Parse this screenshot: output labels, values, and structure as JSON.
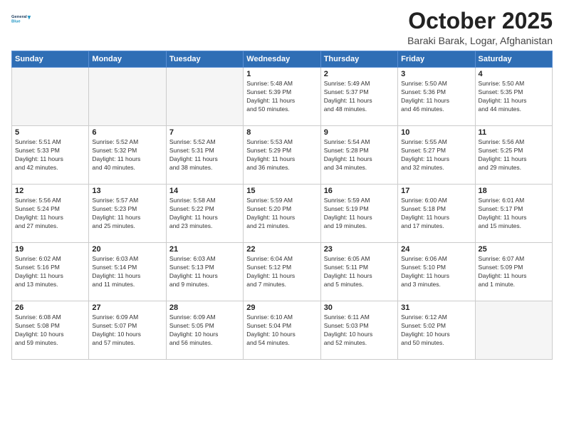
{
  "logo": {
    "line1": "General",
    "line2": "Blue"
  },
  "header": {
    "month": "October 2025",
    "location": "Baraki Barak, Logar, Afghanistan"
  },
  "weekdays": [
    "Sunday",
    "Monday",
    "Tuesday",
    "Wednesday",
    "Thursday",
    "Friday",
    "Saturday"
  ],
  "weeks": [
    [
      {
        "day": "",
        "info": ""
      },
      {
        "day": "",
        "info": ""
      },
      {
        "day": "",
        "info": ""
      },
      {
        "day": "1",
        "info": "Sunrise: 5:48 AM\nSunset: 5:39 PM\nDaylight: 11 hours\nand 50 minutes."
      },
      {
        "day": "2",
        "info": "Sunrise: 5:49 AM\nSunset: 5:37 PM\nDaylight: 11 hours\nand 48 minutes."
      },
      {
        "day": "3",
        "info": "Sunrise: 5:50 AM\nSunset: 5:36 PM\nDaylight: 11 hours\nand 46 minutes."
      },
      {
        "day": "4",
        "info": "Sunrise: 5:50 AM\nSunset: 5:35 PM\nDaylight: 11 hours\nand 44 minutes."
      }
    ],
    [
      {
        "day": "5",
        "info": "Sunrise: 5:51 AM\nSunset: 5:33 PM\nDaylight: 11 hours\nand 42 minutes."
      },
      {
        "day": "6",
        "info": "Sunrise: 5:52 AM\nSunset: 5:32 PM\nDaylight: 11 hours\nand 40 minutes."
      },
      {
        "day": "7",
        "info": "Sunrise: 5:52 AM\nSunset: 5:31 PM\nDaylight: 11 hours\nand 38 minutes."
      },
      {
        "day": "8",
        "info": "Sunrise: 5:53 AM\nSunset: 5:29 PM\nDaylight: 11 hours\nand 36 minutes."
      },
      {
        "day": "9",
        "info": "Sunrise: 5:54 AM\nSunset: 5:28 PM\nDaylight: 11 hours\nand 34 minutes."
      },
      {
        "day": "10",
        "info": "Sunrise: 5:55 AM\nSunset: 5:27 PM\nDaylight: 11 hours\nand 32 minutes."
      },
      {
        "day": "11",
        "info": "Sunrise: 5:56 AM\nSunset: 5:25 PM\nDaylight: 11 hours\nand 29 minutes."
      }
    ],
    [
      {
        "day": "12",
        "info": "Sunrise: 5:56 AM\nSunset: 5:24 PM\nDaylight: 11 hours\nand 27 minutes."
      },
      {
        "day": "13",
        "info": "Sunrise: 5:57 AM\nSunset: 5:23 PM\nDaylight: 11 hours\nand 25 minutes."
      },
      {
        "day": "14",
        "info": "Sunrise: 5:58 AM\nSunset: 5:22 PM\nDaylight: 11 hours\nand 23 minutes."
      },
      {
        "day": "15",
        "info": "Sunrise: 5:59 AM\nSunset: 5:20 PM\nDaylight: 11 hours\nand 21 minutes."
      },
      {
        "day": "16",
        "info": "Sunrise: 5:59 AM\nSunset: 5:19 PM\nDaylight: 11 hours\nand 19 minutes."
      },
      {
        "day": "17",
        "info": "Sunrise: 6:00 AM\nSunset: 5:18 PM\nDaylight: 11 hours\nand 17 minutes."
      },
      {
        "day": "18",
        "info": "Sunrise: 6:01 AM\nSunset: 5:17 PM\nDaylight: 11 hours\nand 15 minutes."
      }
    ],
    [
      {
        "day": "19",
        "info": "Sunrise: 6:02 AM\nSunset: 5:16 PM\nDaylight: 11 hours\nand 13 minutes."
      },
      {
        "day": "20",
        "info": "Sunrise: 6:03 AM\nSunset: 5:14 PM\nDaylight: 11 hours\nand 11 minutes."
      },
      {
        "day": "21",
        "info": "Sunrise: 6:03 AM\nSunset: 5:13 PM\nDaylight: 11 hours\nand 9 minutes."
      },
      {
        "day": "22",
        "info": "Sunrise: 6:04 AM\nSunset: 5:12 PM\nDaylight: 11 hours\nand 7 minutes."
      },
      {
        "day": "23",
        "info": "Sunrise: 6:05 AM\nSunset: 5:11 PM\nDaylight: 11 hours\nand 5 minutes."
      },
      {
        "day": "24",
        "info": "Sunrise: 6:06 AM\nSunset: 5:10 PM\nDaylight: 11 hours\nand 3 minutes."
      },
      {
        "day": "25",
        "info": "Sunrise: 6:07 AM\nSunset: 5:09 PM\nDaylight: 11 hours\nand 1 minute."
      }
    ],
    [
      {
        "day": "26",
        "info": "Sunrise: 6:08 AM\nSunset: 5:08 PM\nDaylight: 10 hours\nand 59 minutes."
      },
      {
        "day": "27",
        "info": "Sunrise: 6:09 AM\nSunset: 5:07 PM\nDaylight: 10 hours\nand 57 minutes."
      },
      {
        "day": "28",
        "info": "Sunrise: 6:09 AM\nSunset: 5:05 PM\nDaylight: 10 hours\nand 56 minutes."
      },
      {
        "day": "29",
        "info": "Sunrise: 6:10 AM\nSunset: 5:04 PM\nDaylight: 10 hours\nand 54 minutes."
      },
      {
        "day": "30",
        "info": "Sunrise: 6:11 AM\nSunset: 5:03 PM\nDaylight: 10 hours\nand 52 minutes."
      },
      {
        "day": "31",
        "info": "Sunrise: 6:12 AM\nSunset: 5:02 PM\nDaylight: 10 hours\nand 50 minutes."
      },
      {
        "day": "",
        "info": ""
      }
    ]
  ]
}
